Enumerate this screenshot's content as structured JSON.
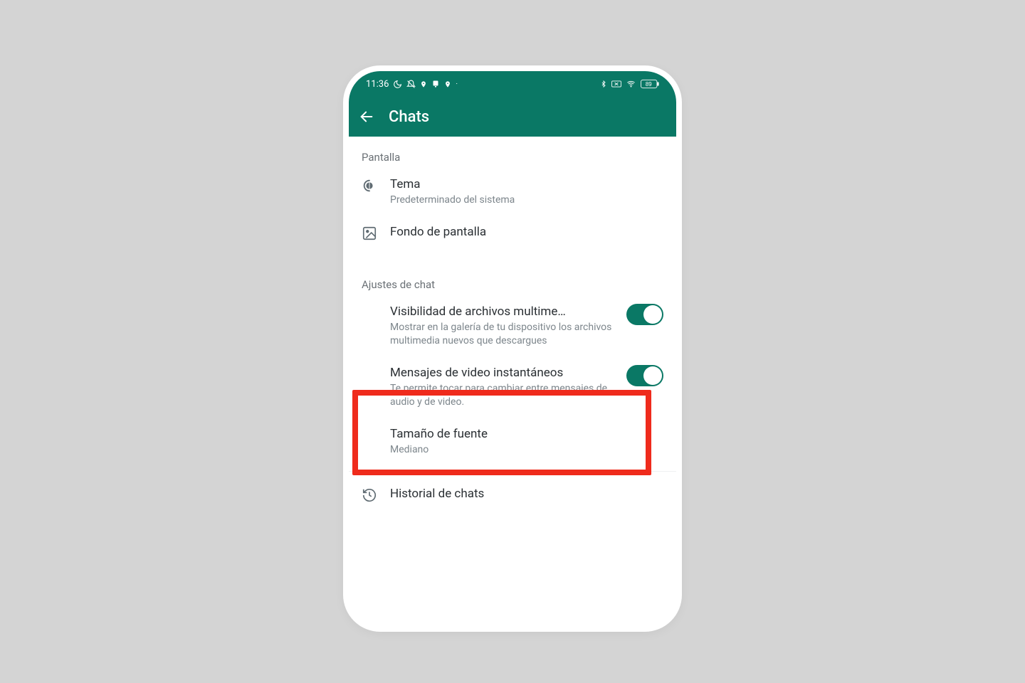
{
  "colors": {
    "accent": "#0a7865",
    "highlight": "#ef2b1c"
  },
  "statusbar": {
    "time": "11:36",
    "battery": "89"
  },
  "appbar": {
    "title": "Chats"
  },
  "sections": {
    "display": {
      "header": "Pantalla",
      "theme": {
        "label": "Tema",
        "value": "Predeterminado del sistema"
      },
      "wallpaper": {
        "label": "Fondo de pantalla"
      }
    },
    "chat": {
      "header": "Ajustes de chat",
      "mediaVisibility": {
        "label": "Visibilidad de archivos multime…",
        "description": "Mostrar en la galería de tu dispositivo los archivos multimedia nuevos que descargues",
        "enabled": true
      },
      "instantVideo": {
        "label": "Mensajes de video instantáneos",
        "description": "Te permite tocar para cambiar entre mensajes de audio y de video.",
        "enabled": true
      },
      "fontSize": {
        "label": "Tamaño de fuente",
        "value": "Mediano"
      }
    },
    "history": {
      "label": "Historial de chats"
    }
  }
}
